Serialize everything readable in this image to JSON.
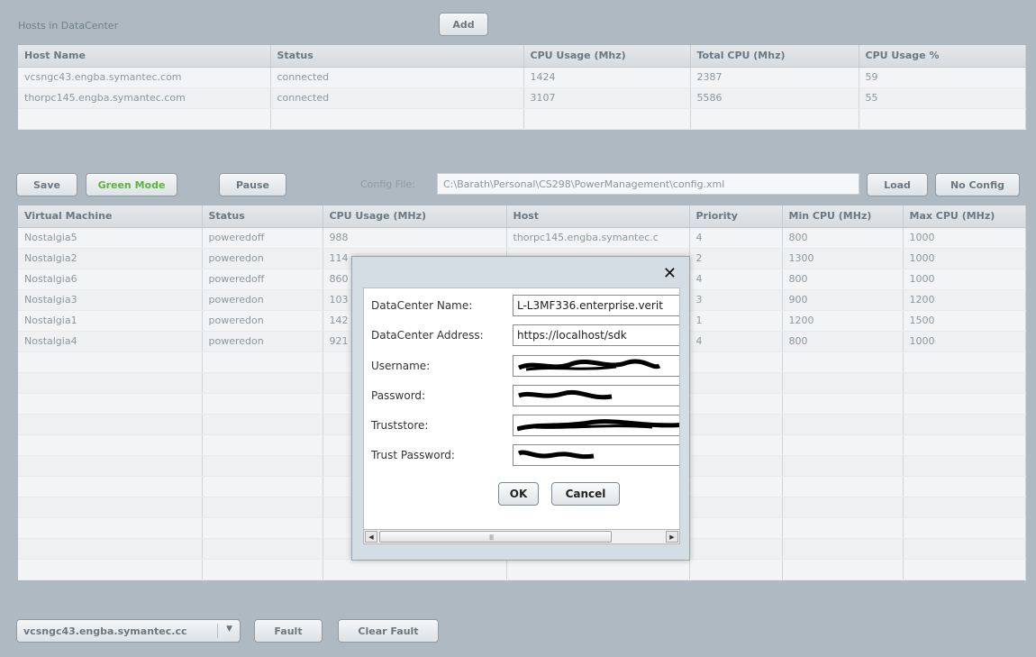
{
  "hosts": {
    "title": "Hosts in DataCenter",
    "add_label": "Add",
    "columns": [
      "Host Name",
      "Status",
      "CPU Usage (Mhz)",
      "Total CPU (Mhz)",
      "CPU Usage %"
    ],
    "rows": [
      [
        "vcsngc43.engba.symantec.com",
        "connected",
        "1424",
        "2387",
        "59"
      ],
      [
        "thorpc145.engba.symantec.com",
        "connected",
        "3107",
        "5586",
        "55"
      ]
    ]
  },
  "toolbar": {
    "save_label": "Save",
    "green_mode_label": "Green Mode",
    "pause_label": "Pause",
    "config_file_label": "Config File:",
    "config_file_value": "C:\\Barath\\Personal\\CS298\\PowerManagement\\config.xml",
    "load_label": "Load",
    "no_config_label": "No Config"
  },
  "vms": {
    "columns": [
      "Virtual Machine",
      "Status",
      "CPU Usage (MHz)",
      "Host",
      "Priority",
      "Min CPU (MHz)",
      "Max CPU (MHz)"
    ],
    "rows": [
      [
        "Nostalgia5",
        "poweredoff",
        "988",
        "thorpc145.engba.symantec.c",
        "4",
        "800",
        "1000"
      ],
      [
        "Nostalgia2",
        "poweredon",
        "114",
        "",
        "2",
        "1300",
        "1000"
      ],
      [
        "Nostalgia6",
        "poweredoff",
        "860",
        "",
        "4",
        "800",
        "1000"
      ],
      [
        "Nostalgia3",
        "poweredon",
        "103",
        "",
        "3",
        "900",
        "1200"
      ],
      [
        "Nostalgia1",
        "poweredon",
        "142",
        "",
        "1",
        "1200",
        "1500"
      ],
      [
        "Nostalgia4",
        "poweredon",
        "921",
        "",
        "4",
        "800",
        "1000"
      ]
    ]
  },
  "bottom": {
    "host_select_value": "vcsngc43.engba.symantec.cc",
    "fault_label": "Fault",
    "clear_fault_label": "Clear Fault"
  },
  "dialog": {
    "close_glyph": "✕",
    "fields": [
      {
        "label": "DataCenter Name:",
        "value": "L-L3MF336.enterprise.verit"
      },
      {
        "label": "DataCenter Address:",
        "value": "https://localhost/sdk"
      },
      {
        "label": "Username:",
        "value": ""
      },
      {
        "label": "Password:",
        "value": ""
      },
      {
        "label": "Truststore:",
        "value": ""
      },
      {
        "label": "Trust Password:",
        "value": ""
      }
    ],
    "ok_label": "OK",
    "cancel_label": "Cancel"
  }
}
